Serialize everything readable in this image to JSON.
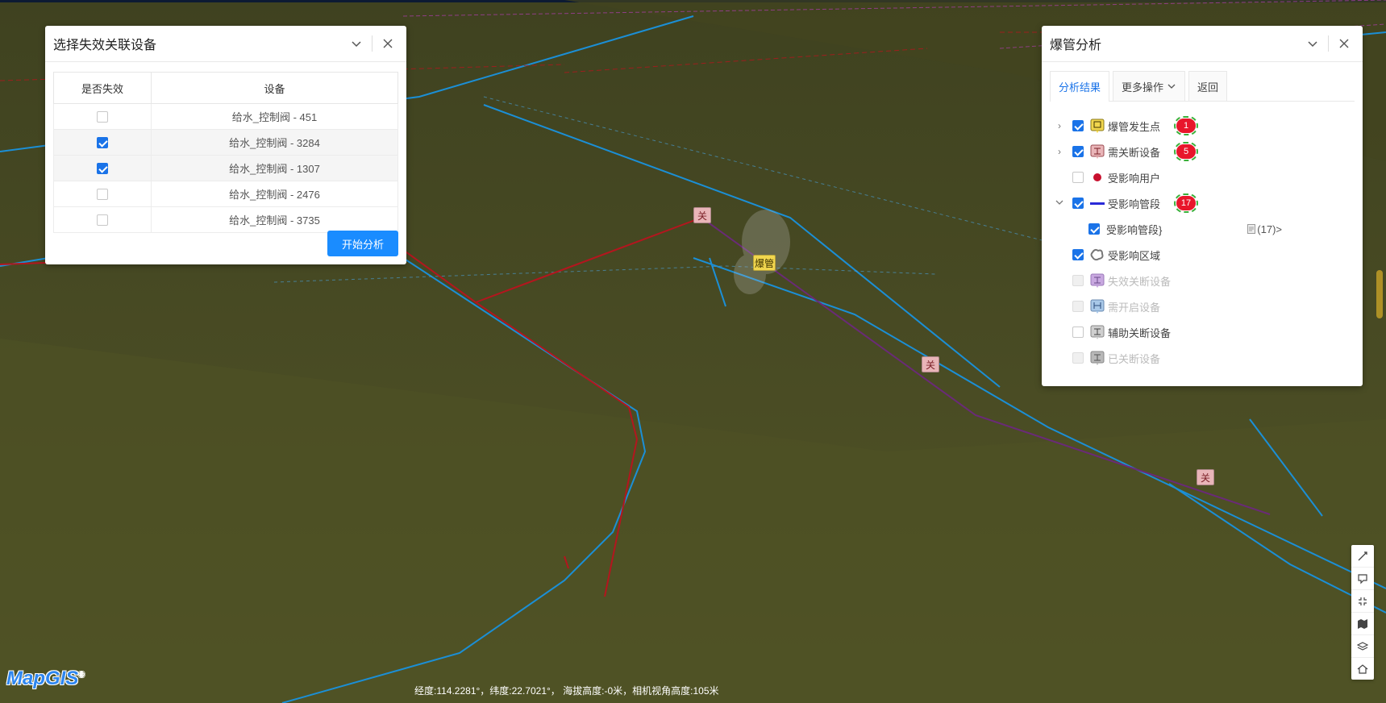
{
  "colors": {
    "map_bg": "#4a4c22",
    "pipe_blue": "#1b8fd6",
    "pipe_red": "#b3161e",
    "pipe_purple": "#6a2a78",
    "accent": "#1a73e8",
    "badge_red": "#e8162b"
  },
  "left_panel": {
    "title": "选择失效关联设备",
    "col_failed": "是否失效",
    "col_device": "设备",
    "rows": [
      {
        "device": "给水_控制阀 - 451",
        "checked": false
      },
      {
        "device": "给水_控制阀 - 3284",
        "checked": true
      },
      {
        "device": "给水_控制阀 - 1307",
        "checked": true
      },
      {
        "device": "给水_控制阀 - 2476",
        "checked": false
      },
      {
        "device": "给水_控制阀 - 3735",
        "checked": false
      }
    ],
    "start_button": "开始分析"
  },
  "right_panel": {
    "title": "爆管分析",
    "tabs": [
      "分析结果",
      "更多操作",
      "返回"
    ],
    "items": [
      {
        "label": "爆管发生点",
        "checked": true,
        "expand": "›",
        "icon": "burst-point-icon",
        "badge": "1"
      },
      {
        "label": "需关断设备",
        "checked": true,
        "expand": "›",
        "icon": "valve-close-icon",
        "badge": "5"
      },
      {
        "label": "受影响用户",
        "checked": false,
        "expand": "",
        "icon": "user-dot-icon",
        "badge": ""
      },
      {
        "label": "受影响管段",
        "checked": true,
        "expand": "⌄",
        "icon": "pipe-line-icon",
        "badge": "17"
      },
      {
        "label": "受影响管段}",
        "checked": true,
        "sub": true,
        "count": "(17)>"
      },
      {
        "label": "受影响区域",
        "checked": true,
        "expand": "",
        "icon": "area-icon",
        "badge": ""
      },
      {
        "label": "失效关断设备",
        "checked": false,
        "disabled": true,
        "icon": "failed-valve-icon"
      },
      {
        "label": "需开启设备",
        "checked": false,
        "disabled": true,
        "icon": "open-valve-icon"
      },
      {
        "label": "辅助关断设备",
        "checked": false,
        "disabled": false,
        "icon": "aux-valve-icon"
      },
      {
        "label": "已关断设备",
        "checked": false,
        "disabled": true,
        "icon": "closed-valve-icon"
      }
    ]
  },
  "map": {
    "markers": [
      {
        "label": "关",
        "type": "guan"
      },
      {
        "label": "爆管",
        "type": "bao"
      },
      {
        "label": "关",
        "type": "guan"
      },
      {
        "label": "关",
        "type": "guan"
      }
    ]
  },
  "status_bar": {
    "text": "经度:114.2281°，纬度:22.7021°， 海拔高度:-0米，相机视角高度:105米"
  },
  "logo": {
    "text": "MapGIS",
    "mark": "®"
  },
  "toolbar": [
    "measure-icon",
    "annotate-icon",
    "fullscreen-icon",
    "map-icon",
    "layers-icon",
    "home-icon"
  ]
}
